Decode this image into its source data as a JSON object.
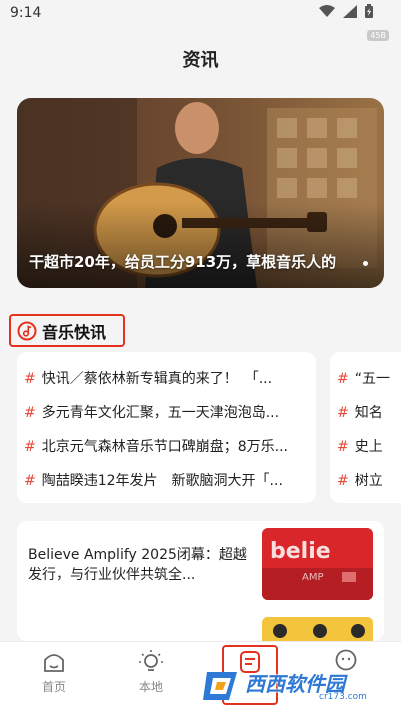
{
  "status_bar": {
    "time": "9:14",
    "badge": "45B"
  },
  "header": {
    "title": "资讯"
  },
  "banner": {
    "caption": "干超市20年，给员工分913万，草根音乐人的"
  },
  "section": {
    "title": "音乐快讯"
  },
  "news_col1": [
    "快讯／蔡依林新专辑真的来了！　「...",
    "多元青年文化汇聚，五一天津泡泡岛...",
    "北京元气森林音乐节口碑崩盘；8万乐...",
    "陶喆睽违12年发片　新歌脑洞大开「..."
  ],
  "news_col2": [
    "“五一",
    "知名",
    "史上",
    "树立"
  ],
  "article": {
    "title": "Believe Amplify 2025闭幕：超越发行，与行业伙伴共筑全..."
  },
  "tabs": [
    {
      "label": "首页",
      "icon": "home-icon"
    },
    {
      "label": "本地",
      "icon": "bulb-icon"
    },
    {
      "label": "",
      "icon": "news-icon"
    },
    {
      "label": "",
      "icon": "chat-icon"
    }
  ],
  "watermark": {
    "text": "西西软件园",
    "sub": "cr173.com"
  },
  "colors": {
    "accent": "#e3321f",
    "hash": "#e8493a"
  }
}
